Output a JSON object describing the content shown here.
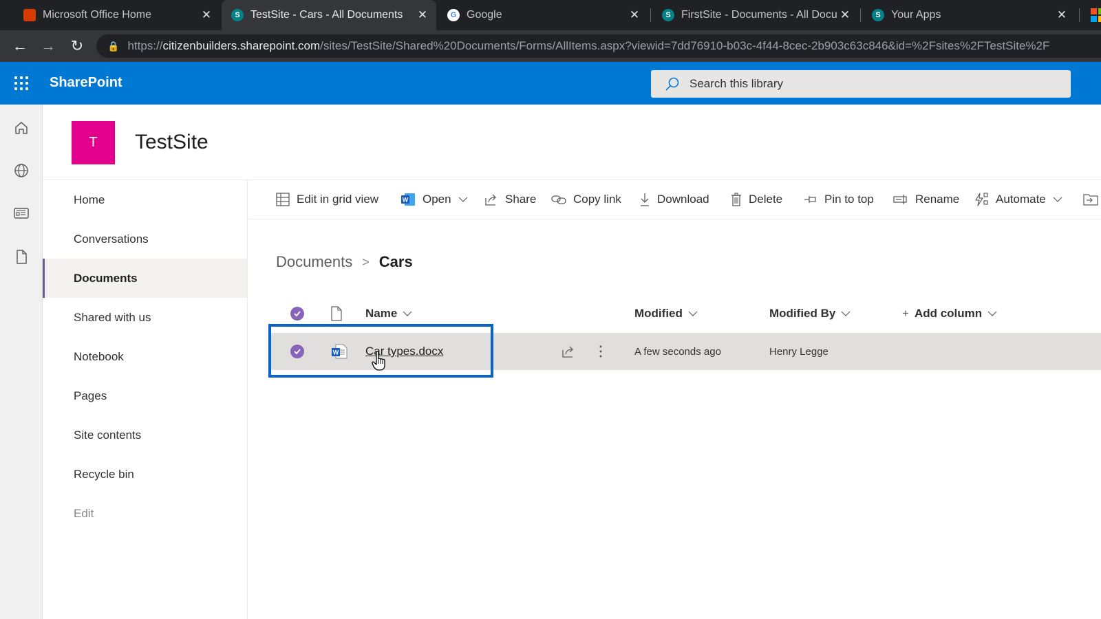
{
  "browser": {
    "tabs": [
      {
        "title": "Microsoft Office Home",
        "icon": "office-icon",
        "active": false
      },
      {
        "title": "TestSite - Cars - All Documents",
        "icon": "sharepoint-icon",
        "active": true
      },
      {
        "title": "Google",
        "icon": "google-icon",
        "active": false
      },
      {
        "title": "FirstSite - Documents - All Docun",
        "icon": "sharepoint-icon",
        "active": false
      },
      {
        "title": "Your Apps",
        "icon": "sharepoint-icon",
        "active": false
      }
    ],
    "close_glyph": "✕",
    "url_scheme": "https://",
    "url_host": "citizenbuilders.sharepoint.com",
    "url_path": "/sites/TestSite/Shared%20Documents/Forms/AllItems.aspx?viewid=7dd76910-b03c-4f44-8cec-2b903c63c846&id=%2Fsites%2FTestSite%2F",
    "nav": {
      "back": "←",
      "forward": "→",
      "reload": "↻"
    }
  },
  "suitebar": {
    "brand": "SharePoint",
    "search_placeholder": "Search this library",
    "brand_color": "#0078d4"
  },
  "site": {
    "logo_letter": "T",
    "title": "TestSite",
    "logo_color": "#e3008c"
  },
  "leftnav": {
    "items": [
      {
        "label": "Home",
        "selected": false
      },
      {
        "label": "Conversations",
        "selected": false
      },
      {
        "label": "Documents",
        "selected": true
      },
      {
        "label": "Shared with us",
        "selected": false
      },
      {
        "label": "Notebook",
        "selected": false
      },
      {
        "label": "Pages",
        "selected": false
      },
      {
        "label": "Site contents",
        "selected": false
      },
      {
        "label": "Recycle bin",
        "selected": false
      }
    ],
    "edit_label": "Edit"
  },
  "commandbar": {
    "edit_grid": "Edit in grid view",
    "open": "Open",
    "share": "Share",
    "copy_link": "Copy link",
    "download": "Download",
    "delete": "Delete",
    "pin": "Pin to top",
    "rename": "Rename",
    "automate": "Automate"
  },
  "breadcrumb": {
    "parent": "Documents",
    "separator": ">",
    "current": "Cars"
  },
  "list": {
    "columns": {
      "name": "Name",
      "modified": "Modified",
      "modified_by": "Modified By",
      "add_column": "Add column"
    },
    "rows": [
      {
        "name": "Car types.docx",
        "modified": "A few seconds ago",
        "modified_by": "Henry Legge",
        "selected": true,
        "type": "word-document"
      }
    ]
  }
}
